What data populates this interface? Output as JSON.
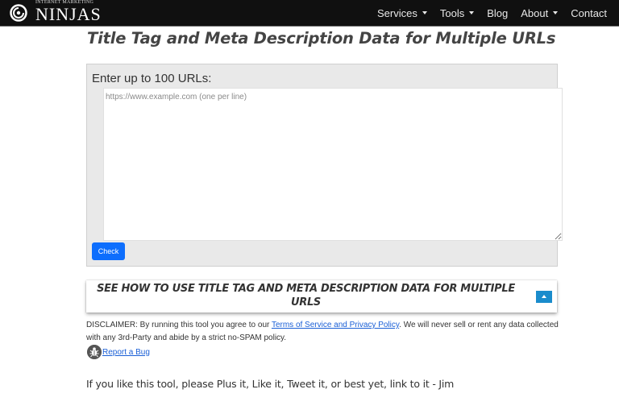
{
  "header": {
    "logo_small": "INTERNET MARKETING",
    "logo_big": "NINJAS",
    "nav": [
      {
        "label": "Services",
        "has_dropdown": true
      },
      {
        "label": "Tools",
        "has_dropdown": true
      },
      {
        "label": "Blog",
        "has_dropdown": false
      },
      {
        "label": "About",
        "has_dropdown": true
      },
      {
        "label": "Contact",
        "has_dropdown": false
      }
    ]
  },
  "main": {
    "title": "Title Tag and Meta Description Data for Multiple URLs",
    "form": {
      "label": "Enter up to 100 URLs:",
      "textarea_value": "",
      "textarea_placeholder": "https://www.example.com (one per line)",
      "check_button": "Check"
    },
    "howto": {
      "text": "SEE HOW TO USE TITLE TAG AND META DESCRIPTION DATA FOR MULTIPLE URLS",
      "toggle_icon": "caret-up-icon"
    },
    "disclaimer": {
      "prefix": "DISCLAIMER: By running this tool you agree to our ",
      "link": "Terms of Service and Privacy Policy",
      "suffix": ". We will never sell or rent any data collected with any 3rd-Party and abide by a strict no-SPAM policy."
    },
    "report_bug": {
      "icon": "bug-icon",
      "label": "Report a Bug"
    },
    "like_text": "If you like this tool, please Plus it, Like it, Tweet it, or best yet, link to it - Jim"
  },
  "colors": {
    "header_bg": "#101010",
    "button_primary": "#0d6efd",
    "toggle_bg": "#1a8ccc",
    "link": "#1a5fd6",
    "panel_bg": "#e9e9e9"
  }
}
